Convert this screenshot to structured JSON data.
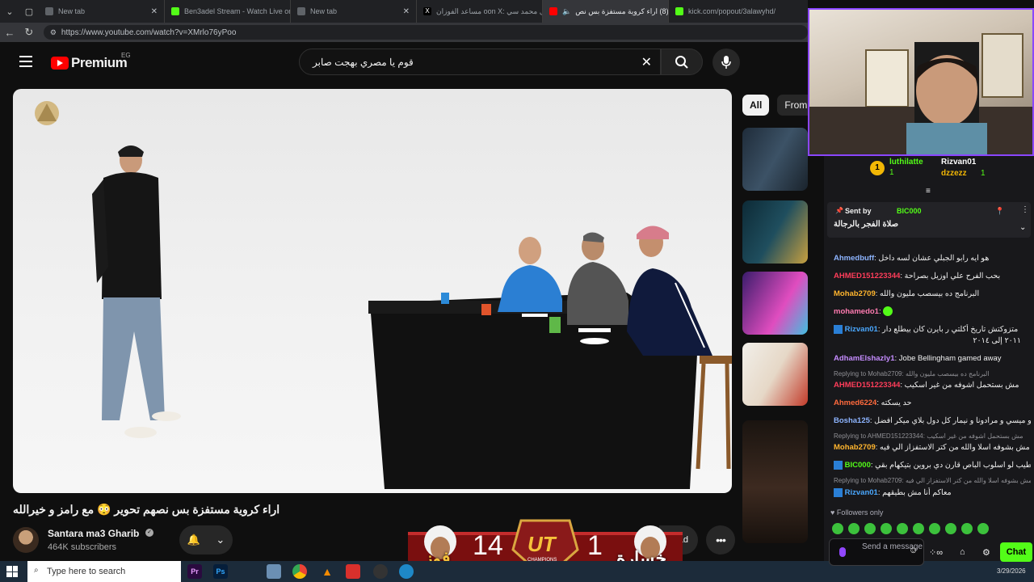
{
  "browser": {
    "tabs": [
      {
        "title": "New tab",
        "icon": "globe-icon"
      },
      {
        "title": "Ben3adel Stream - Watch Live on",
        "icon": "kick-icon"
      },
      {
        "title": "New tab",
        "icon": "globe-icon"
      },
      {
        "title": "\"هل محمد سي :oon X مساعد الفوزان",
        "icon": "x-icon"
      },
      {
        "title": "(8) اراء كروية مستفزة بس نص",
        "icon": "youtube-icon"
      },
      {
        "title": "kick.com/popout/3alawyhd/",
        "icon": "kick-icon"
      }
    ],
    "url": "https://www.youtube.com/watch?v=XMrlo76yPoo"
  },
  "youtube": {
    "brand": "Premium",
    "region": "EG",
    "search_query": "قوم يا مصري بهجت صابر",
    "chips": [
      "All",
      "From"
    ],
    "video_title": "اراء كروية مستفزة بس نصهم تحوير 😳 مع رامز و خيرالله",
    "channel_name": "Santara ma3 Gharib",
    "subscribers": "464K subscribers",
    "download_label": "oad"
  },
  "overlay": {
    "left_word": "فوز",
    "left_score": "14",
    "badge": "UT",
    "badge_sub": "CHAMPIONS",
    "right_score": "1",
    "right_word": "خسارة"
  },
  "taskbar": {
    "search_placeholder": "Type here to search",
    "date": "3/29/2026"
  },
  "chat": {
    "leaderboard": [
      {
        "name": "luthilatte",
        "count": "1"
      },
      {
        "name": "Rizvan01",
        "count": "1"
      },
      {
        "name": "dzzezz",
        "count": "1"
      }
    ],
    "pinned": {
      "label": "Sent by",
      "user": "BIC000",
      "text": "صلاة الفجر بالرجالة"
    },
    "messages": [
      {
        "user": "Ahmedbuff",
        "text": "هو ايه رابو الجبلي عشان لسه داخل",
        "color": "#8db4ff"
      },
      {
        "user": "AHMED151223344",
        "text": "بحب الفرح علي اوزيل بصراحة",
        "color": "#ff3d5a"
      },
      {
        "user": "Mohab2709",
        "text": "البرنامج ده بيسصب مليون والله",
        "color": "#ffb52e"
      },
      {
        "user": "mohamedo1",
        "text": "",
        "color": "#ff7bb0"
      },
      {
        "user": "Rizvan01",
        "text": "متزوكتش تاريخ أكلتي ر بايرن كان بيطلع دار",
        "text2": "٢٠١١ إلى ٢٠١٤",
        "color": "#4aa8ff"
      },
      {
        "user": "AdhamElshazly1",
        "text": "Jobe Bellingham gamed away",
        "color": "#c58cff"
      },
      {
        "reply": "Replying to Mohab2709: البرنامج ده بيسصب مليون والله"
      },
      {
        "user": "AHMED151223344",
        "text": "مش بستحمل اشوفه من غير اسكيب",
        "color": "#ff3d5a"
      },
      {
        "user": "Ahmed6224",
        "text": "حد يسكته",
        "color": "#ff6a3d"
      },
      {
        "user": "Bosha125",
        "text": "و ميسي و مرادونا و نيمار كل دول بلاي ميكر افضل",
        "color": "#8db4ff"
      },
      {
        "reply": "Replying to AHMED151223344: مش بستحمل اشوفه من غير اسكيب"
      },
      {
        "user": "Mohab2709",
        "text": "مش بشوفه اسلا والله من كتر الاستفزاز الي فيه",
        "color": "#ffb52e"
      },
      {
        "user": "BIC000",
        "text": "طيب لو اسلوب الباص قارن دي بروين بتيكهام بقي",
        "color": "#53fc18"
      },
      {
        "reply": "Replying to Mohab2709: مش بشوفه اسلا والله من كتر الاستفزاز الي فيه"
      },
      {
        "user": "Rizvan01",
        "text": "معاكم أنا مش بطيقهم",
        "color": "#4aa8ff"
      }
    ],
    "followers_only": "Followers only",
    "input_placeholder": "Send a message",
    "chat_button": "Chat"
  }
}
